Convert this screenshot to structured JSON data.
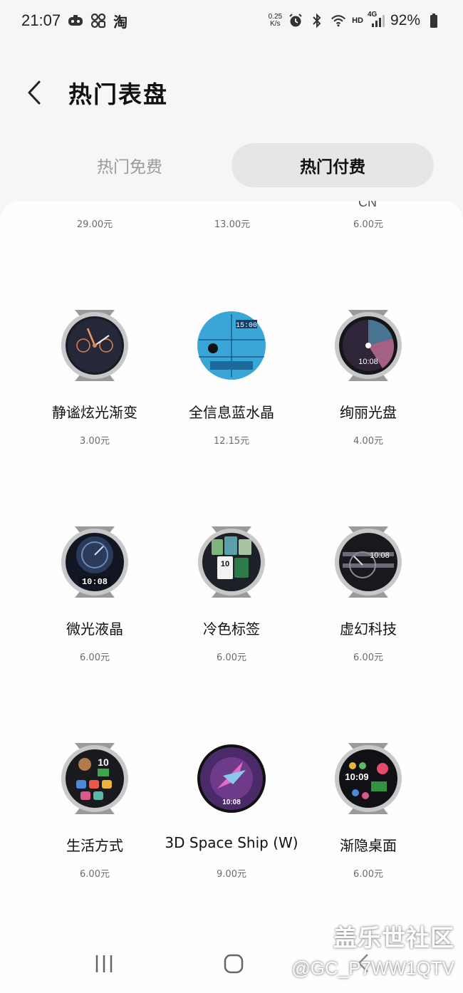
{
  "status_bar": {
    "time": "21:07",
    "app_label": "淘",
    "speed_value": "0.25",
    "speed_unit": "K/s",
    "hd_label": "HD",
    "network_label": "4G",
    "battery_pct": "92%"
  },
  "header": {
    "title": "热门表盘"
  },
  "tabs": [
    {
      "label": "热门免费",
      "selected": false
    },
    {
      "label": "热门付费",
      "selected": true
    }
  ],
  "cut_row": {
    "partial_name": "CN",
    "prices": [
      "29.00元",
      "13.00元",
      "6.00元"
    ]
  },
  "watch_faces": [
    {
      "name": "静谧炫光渐变",
      "price": "3.00元",
      "icon": "dark-gradient-watch-icon",
      "face_text": ""
    },
    {
      "name": "全信息蓝水晶",
      "price": "12.15元",
      "icon": "blue-crystal-watch-icon",
      "face_text": "15:00"
    },
    {
      "name": "绚丽光盘",
      "price": "4.00元",
      "icon": "colorful-disc-watch-icon",
      "face_text": "10:08"
    },
    {
      "name": "微光液晶",
      "price": "6.00元",
      "icon": "lcd-glow-watch-icon",
      "face_text": "10:08"
    },
    {
      "name": "冷色标签",
      "price": "6.00元",
      "icon": "cool-tags-watch-icon",
      "face_text": "10"
    },
    {
      "name": "虚幻科技",
      "price": "6.00元",
      "icon": "virtual-tech-watch-icon",
      "face_text": "10:08"
    },
    {
      "name": "生活方式",
      "price": "6.00元",
      "icon": "lifestyle-watch-icon",
      "face_text": "10"
    },
    {
      "name": "3D Space Ship (W)",
      "price": "9.00元",
      "icon": "space-ship-watch-icon",
      "face_text": "10:08"
    },
    {
      "name": "渐隐桌面",
      "price": "6.00元",
      "icon": "fade-desktop-watch-icon",
      "face_text": "10:09"
    }
  ],
  "watermark": {
    "site": "盖乐世社区",
    "user": "@GC_P7WW1QTV"
  },
  "colors": {
    "background": "#f6f6f6",
    "card": "#fefefe",
    "selected_tab": "#e6e6e8",
    "muted_text": "#9a9a9a"
  }
}
